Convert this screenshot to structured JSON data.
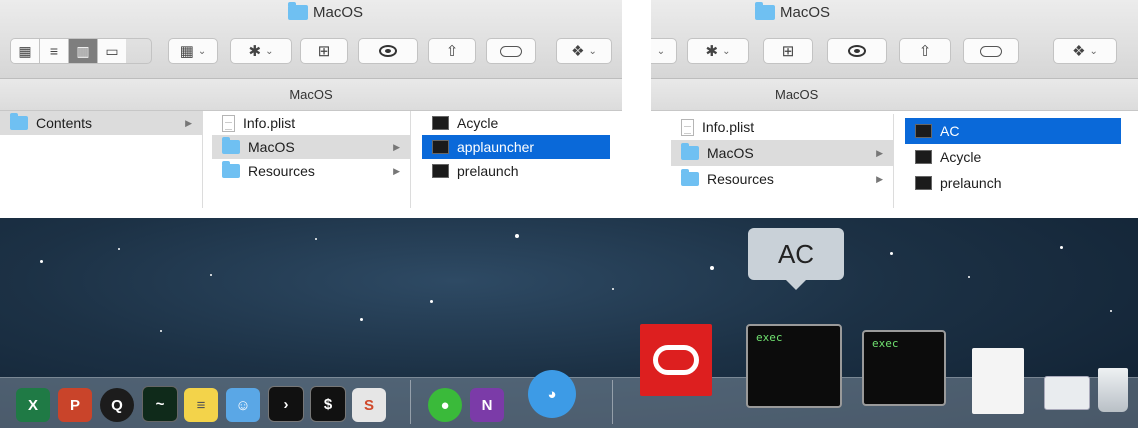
{
  "finder_left": {
    "window_title": "MacOS",
    "path_bar": "MacOS",
    "columns": [
      {
        "items": [
          {
            "name": "Contents",
            "kind": "folder",
            "state": "parent"
          }
        ]
      },
      {
        "items": [
          {
            "name": "Info.plist",
            "kind": "file",
            "state": "normal"
          },
          {
            "name": "MacOS",
            "kind": "folder",
            "state": "parent"
          },
          {
            "name": "Resources",
            "kind": "folder",
            "state": "normal"
          }
        ]
      },
      {
        "items": [
          {
            "name": "Acycle",
            "kind": "exec",
            "state": "normal"
          },
          {
            "name": "applauncher",
            "kind": "exec",
            "state": "selected"
          },
          {
            "name": "prelaunch",
            "kind": "exec",
            "state": "normal"
          }
        ]
      }
    ]
  },
  "finder_right": {
    "window_title": "MacOS",
    "path_bar": "MacOS",
    "columns": [
      {
        "items": [
          {
            "name": "Info.plist",
            "kind": "file",
            "state": "normal"
          },
          {
            "name": "MacOS",
            "kind": "folder",
            "state": "parent"
          },
          {
            "name": "Resources",
            "kind": "folder",
            "state": "normal"
          }
        ]
      },
      {
        "items": [
          {
            "name": "AC",
            "kind": "exec",
            "state": "selected"
          },
          {
            "name": "Acycle",
            "kind": "exec",
            "state": "normal"
          },
          {
            "name": "prelaunch",
            "kind": "exec",
            "state": "normal"
          }
        ]
      }
    ]
  },
  "dock": {
    "tooltip": "AC",
    "terminal_label_1": "exec",
    "terminal_label_2": "exec",
    "icons": [
      "excel-icon",
      "powerpoint-icon",
      "qq-icon",
      "activity-monitor-icon",
      "stickies-icon",
      "finder-icon",
      "terminal-icon",
      "terminal-icon",
      "sublime-icon",
      "wechat-icon",
      "onenote-icon",
      "dingtalk-icon",
      "creative-cloud-icon",
      "exec-icon",
      "exec-icon",
      "document-icon",
      "preview-icon",
      "trash-icon"
    ]
  }
}
